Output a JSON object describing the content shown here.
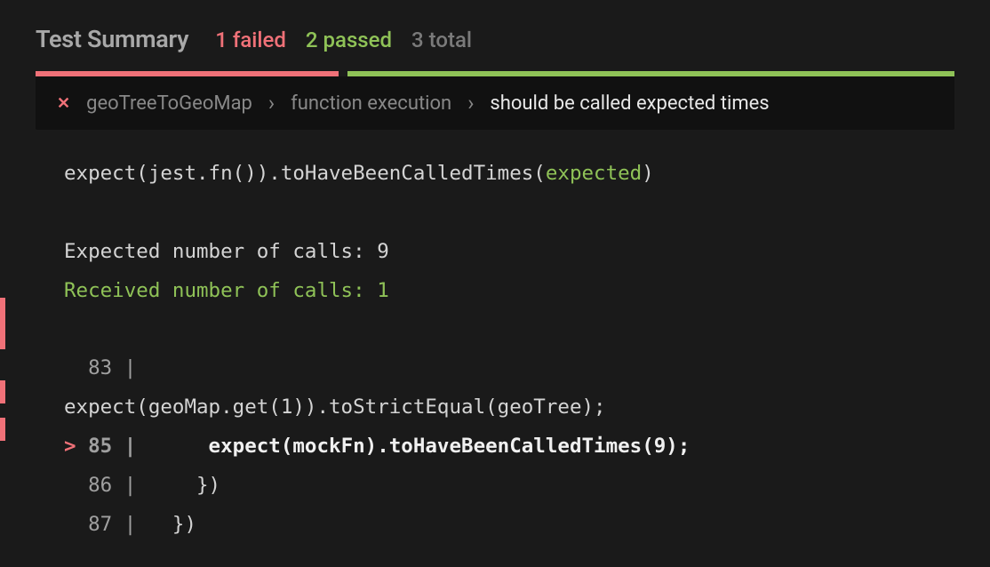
{
  "header": {
    "title": "Test Summary",
    "failed": "1 failed",
    "passed": "2 passed",
    "total": "3 total"
  },
  "breadcrumb": {
    "c1": "geoTreeToGeoMap",
    "c2": "function execution",
    "c3": "should be called expected times"
  },
  "code": {
    "l1a": "expect(jest.fn()).toHaveBeenCalledTimes(",
    "l1b": "expected",
    "l1c": ")",
    "l3": "Expected number of calls: 9",
    "l4": "Received number of calls: 1",
    "l6n": "  83 |",
    "l7": "expect(geoMap.get(1)).toStrictEqual(geoTree);",
    "l8caret": ">",
    "l8n": " 85 |",
    "l8b": "      expect(mockFn).toHaveBeenCalledTimes(9);",
    "l9n": "  86 |",
    "l9b": "     })",
    "l10n": "  87 |",
    "l10b": "   })"
  }
}
